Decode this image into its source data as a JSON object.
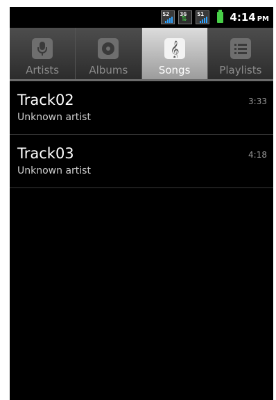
{
  "status_bar": {
    "sim1_label": "S2",
    "data_label": "3G",
    "sim2_label": "S1",
    "time": "4:14",
    "ampm": "PM",
    "battery_color": "#48d048",
    "signal_color": "#2fa3ff"
  },
  "tabs": [
    {
      "label": "Artists",
      "icon": "microphone-icon",
      "active": false
    },
    {
      "label": "Albums",
      "icon": "album-icon",
      "active": false
    },
    {
      "label": "Songs",
      "icon": "music-note-icon",
      "active": true
    },
    {
      "label": "Playlists",
      "icon": "playlist-icon",
      "active": false
    }
  ],
  "songs": [
    {
      "title": "Track02",
      "artist": "Unknown artist",
      "duration": "3:33"
    },
    {
      "title": "Track03",
      "artist": "Unknown artist",
      "duration": "4:18"
    }
  ]
}
